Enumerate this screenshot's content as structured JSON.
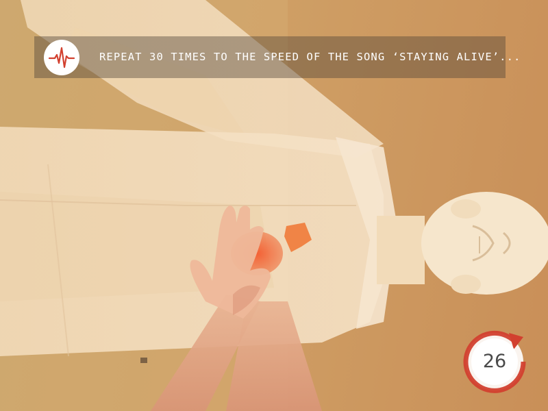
{
  "instruction": {
    "icon": "heartbeat-icon",
    "text": "REPEAT 30 TIMES TO THE SPEED OF THE SONG ‘STAYING ALIVE’..."
  },
  "counter": {
    "icon": "repeat-arrow-icon",
    "value": "26"
  },
  "colors": {
    "accent": "#d2402f",
    "banner": "#4e4238",
    "counter_fill": "#ffffff",
    "counter_text": "#4a4a4a"
  }
}
